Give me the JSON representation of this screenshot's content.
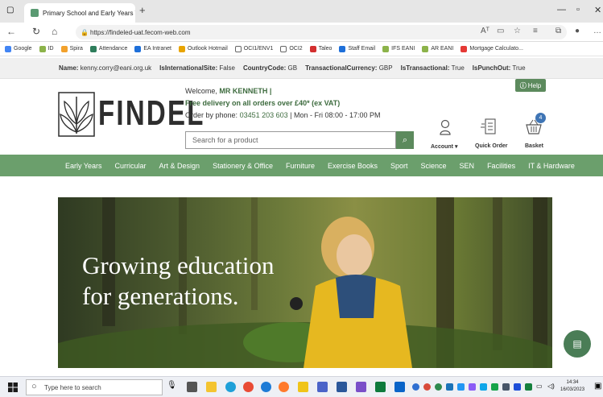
{
  "browser": {
    "tab_title": "Primary School and Early Years T",
    "url": "https://findeled-uat.fecom-web.com",
    "address_right_text": "Aᵀ",
    "favorites": [
      "Google",
      "ID",
      "Spira",
      "Attendance",
      "EA Intranet",
      "Outlook Hotmail",
      "OCI1/ENV1",
      "OCI2",
      "Taleo",
      "Staff Email",
      "IFS EANI",
      "AR EANI",
      "Mortgage Calculato..."
    ]
  },
  "infobar": {
    "items": [
      {
        "label": "Name:",
        "value": "kenny.corry@eani.org.uk"
      },
      {
        "label": "IsInternationalSite:",
        "value": "False"
      },
      {
        "label": "CountryCode:",
        "value": "GB"
      },
      {
        "label": "TransactionalCurrency:",
        "value": "GBP"
      },
      {
        "label": "IsTransactional:",
        "value": "True"
      },
      {
        "label": "IsPunchOut:",
        "value": "True"
      }
    ]
  },
  "header": {
    "logo": "FINDEL",
    "welcome_prefix": "Welcome,",
    "welcome_name": "MR KENNETH |",
    "delivery": "Free delivery on all orders over £40* (ex VAT)",
    "phone_prefix": "Order by phone:",
    "phone_number": "03451 203 603",
    "phone_hours": "| Mon - Fri 08:00 - 17:00 PM",
    "search_placeholder": "Search for a product",
    "help": "Help",
    "account": "Account",
    "quick_order": "Quick Order",
    "basket": "Basket",
    "basket_count": "4"
  },
  "nav": [
    "Early Years",
    "Curricular",
    "Art & Design",
    "Stationery & Office",
    "Furniture",
    "Exercise Books",
    "Sport",
    "Science",
    "SEN",
    "Facilities",
    "IT & Hardware"
  ],
  "hero": {
    "line1": "Growing education",
    "line2": "for generations."
  },
  "taskbar": {
    "search": "Type here to search",
    "time": "14:34",
    "date": "16/03/2023"
  },
  "colors": {
    "brand_green": "#6b9f6c",
    "dark_green": "#3d6b3e",
    "badge_blue": "#3f75b5"
  }
}
